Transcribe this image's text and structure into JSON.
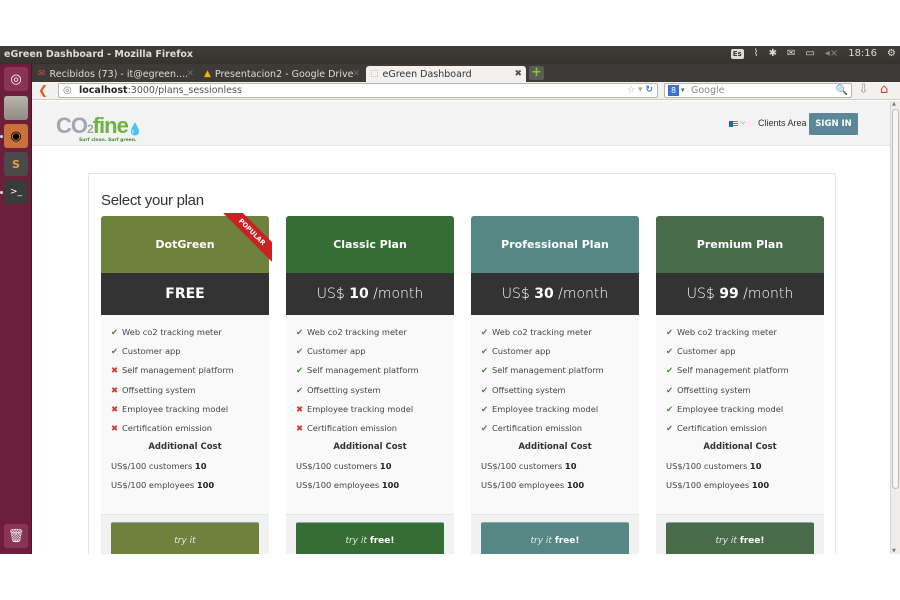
{
  "os": {
    "window_title": "eGreen Dashboard - Mozilla Firefox",
    "tray": {
      "keyboard": "Es",
      "clock": "18:16"
    },
    "launcher": [
      "dash-home",
      "files",
      "firefox",
      "sublime-text",
      "terminal",
      "trash"
    ]
  },
  "browser": {
    "tabs": [
      {
        "label": "Recibidos (73) - it@egreen....",
        "icon": "gmail-icon",
        "active": false
      },
      {
        "label": "Presentacion2 - Google Drive",
        "icon": "google-drive-icon",
        "active": false
      },
      {
        "label": "eGreen Dashboard",
        "icon": "blank-page-icon",
        "active": true
      }
    ],
    "url_host": "localhost",
    "url_path": ":3000/plans_sessionless",
    "search_placeholder": "Google"
  },
  "site": {
    "logo": {
      "co": "CO",
      "two": "2",
      "fine": "fine",
      "tagline": "Surf clean. Surf green."
    },
    "clients_area": "Clients Area",
    "sign_in": "SIGN IN",
    "page_title": "Select your plan",
    "popular_label": "POPULAR",
    "additional_cost_label": "Additional Cost",
    "plans": [
      {
        "name": "DotGreen",
        "color": "#6f823d",
        "price_text": "FREE",
        "popular": true,
        "features": [
          {
            "label": "Web co2 tracking meter",
            "included": true
          },
          {
            "label": "Customer app",
            "included": true
          },
          {
            "label": "Self management platform",
            "included": false
          },
          {
            "label": "Offsetting system",
            "included": false
          },
          {
            "label": "Employee tracking model",
            "included": false
          },
          {
            "label": "Certification emission",
            "included": false
          }
        ],
        "costs": [
          {
            "label": "US$/100 customers",
            "value": "10"
          },
          {
            "label": "US$/100 employees",
            "value": "100"
          }
        ],
        "cta_italic": "try it",
        "cta_bold": ""
      },
      {
        "name": "Classic Plan",
        "color": "#356d35",
        "price_prefix": "US$",
        "price_amount": "10",
        "price_suffix": "/month",
        "popular": false,
        "features": [
          {
            "label": "Web co2 tracking meter",
            "included": true
          },
          {
            "label": "Customer app",
            "included": true
          },
          {
            "label": "Self management platform",
            "included": true
          },
          {
            "label": "Offsetting system",
            "included": true
          },
          {
            "label": "Employee tracking model",
            "included": false
          },
          {
            "label": "Certification emission",
            "included": false
          }
        ],
        "costs": [
          {
            "label": "US$/100 customers",
            "value": "10"
          },
          {
            "label": "US$/100 employees",
            "value": "100"
          }
        ],
        "cta_italic": "try it",
        "cta_bold": "free!"
      },
      {
        "name": "Professional Plan",
        "color": "#558885",
        "price_prefix": "US$",
        "price_amount": "30",
        "price_suffix": "/month",
        "popular": false,
        "features": [
          {
            "label": "Web co2 tracking meter",
            "included": true
          },
          {
            "label": "Customer app",
            "included": true
          },
          {
            "label": "Self management platform",
            "included": true
          },
          {
            "label": "Offsetting system",
            "included": true
          },
          {
            "label": "Employee tracking model",
            "included": true
          },
          {
            "label": "Certification emission",
            "included": true
          }
        ],
        "costs": [
          {
            "label": "US$/100 customers",
            "value": "10"
          },
          {
            "label": "US$/100 employees",
            "value": "100"
          }
        ],
        "cta_italic": "try it",
        "cta_bold": "free!"
      },
      {
        "name": "Premium Plan",
        "color": "#4a6b4a",
        "price_prefix": "US$",
        "price_amount": "99",
        "price_suffix": "/month",
        "popular": false,
        "features": [
          {
            "label": "Web co2 tracking meter",
            "included": true
          },
          {
            "label": "Customer app",
            "included": true
          },
          {
            "label": "Self management platform",
            "included": true
          },
          {
            "label": "Offsetting system",
            "included": true
          },
          {
            "label": "Employee tracking model",
            "included": true
          },
          {
            "label": "Certification emission",
            "included": true
          }
        ],
        "costs": [
          {
            "label": "US$/100 customers",
            "value": "10"
          },
          {
            "label": "US$/100 employees",
            "value": "100"
          }
        ],
        "cta_italic": "try it",
        "cta_bold": "free!"
      }
    ]
  },
  "colors": {
    "launcher": "#6b1f3b",
    "price_band": "#333333",
    "sign_in": "#5b8799",
    "check": "#3f8e2f",
    "cross": "#d43a2b"
  }
}
